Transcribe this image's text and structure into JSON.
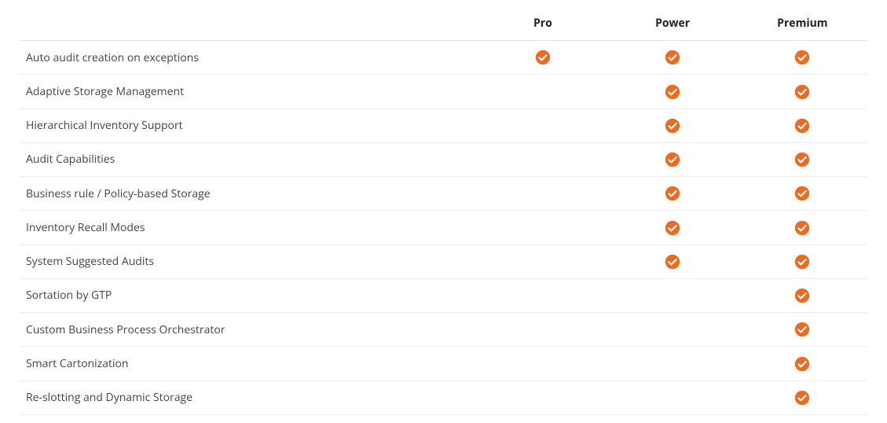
{
  "columns": {
    "feature": "",
    "plans": [
      "Pro",
      "Power",
      "Premium"
    ]
  },
  "rows": [
    {
      "label": "Auto audit creation on exceptions",
      "pro": true,
      "power": true,
      "premium": true
    },
    {
      "label": "Adaptive Storage Management",
      "pro": false,
      "power": true,
      "premium": true
    },
    {
      "label": "Hierarchical Inventory Support",
      "pro": false,
      "power": true,
      "premium": true
    },
    {
      "label": "Audit Capabilities",
      "pro": false,
      "power": true,
      "premium": true
    },
    {
      "label": "Business rule / Policy-based Storage",
      "pro": false,
      "power": true,
      "premium": true
    },
    {
      "label": "Inventory Recall Modes",
      "pro": false,
      "power": true,
      "premium": true
    },
    {
      "label": "System Suggested Audits",
      "pro": false,
      "power": true,
      "premium": true
    },
    {
      "label": "Sortation by GTP",
      "pro": false,
      "power": false,
      "premium": true
    },
    {
      "label": "Custom Business Process Orchestrator",
      "pro": false,
      "power": false,
      "premium": true
    },
    {
      "label": "Smart Cartonization",
      "pro": false,
      "power": false,
      "premium": true
    },
    {
      "label": "Re-slotting and Dynamic Storage",
      "pro": false,
      "power": false,
      "premium": true
    }
  ],
  "icon_color": "#ed6a1f"
}
